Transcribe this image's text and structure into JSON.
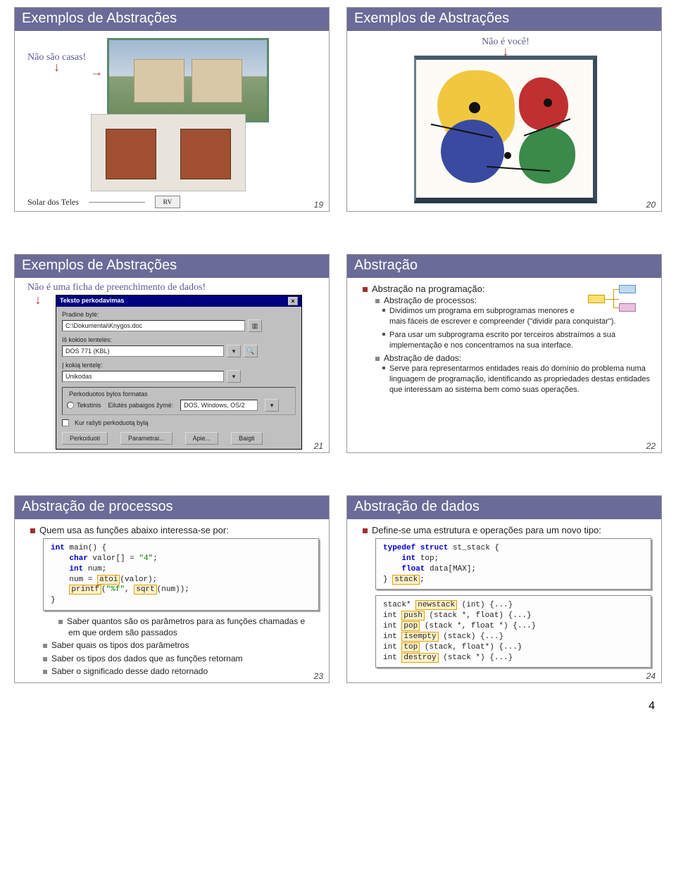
{
  "page_number_bottom": "4",
  "slides": {
    "s19": {
      "title": "Exemplos de Abstrações",
      "annotation": "Não são casas!",
      "bottom_label": "Solar dos Teles",
      "rv_label": "RV",
      "num": "19"
    },
    "s20": {
      "title": "Exemplos de Abstrações",
      "annotation": "Não é você!",
      "num": "20"
    },
    "s21": {
      "title": "Exemplos de Abstrações",
      "annotation": "Não é uma ficha de preenchimento de dados!",
      "dialog": {
        "title": "Teksto perkodavimas",
        "close": "×",
        "f1_label": "Pradinė bylė:",
        "f1_value": "C:\\Dokumentai\\Knygos.doc",
        "f2_label": "Iš kokios lentelės:",
        "f2_value": "DOS 771 (KBL)",
        "f3_label": "Į kokią lentelę:",
        "f3_value": "Unikodas",
        "row_label": "Perkoduotos bylos formatas",
        "opt1": "Tekstinis",
        "opt2_prefix": "Eilutės pabaigos žymė:",
        "opt2_value": "DOS, Windows, OS/2",
        "chk_label": "Kur rašyti perkoduotą bylą",
        "buttons": [
          "Perkoduoti",
          "Parametrai...",
          "Apie...",
          "Baigti"
        ]
      },
      "num": "21"
    },
    "s22": {
      "title": "Abstração",
      "l1": "Abstração na programação:",
      "l2a": "Abstração de processos:",
      "l3a": "Dividimos um programa em subprogramas menores e mais fáceis de escrever e compreender (\"dividir para conquistar\").",
      "l3b": "Para usar um subprograma escrito por terceiros abstraímos a sua implementação e nos concentramos na sua interface.",
      "l2b": "Abstração de dados:",
      "l3c": "Serve para representarmos entidades reais do domínio do problema numa linguagem de programação, identificando as propriedades destas entidades que interessam ao sistema bem como suas operações.",
      "num": "22"
    },
    "s23": {
      "title": "Abstração de processos",
      "l1": "Quem usa as funções abaixo interessa-se por:",
      "code": {
        "l1a": "int",
        "l1b": " main() {",
        "l2a": "char",
        "l2b": " valor[] = ",
        "l2c": "\"4\"",
        "l2d": ";",
        "l3a": "int",
        "l3b": " num;",
        "l4a": "    num = ",
        "l4b": "atoi",
        "l4c": "(valor);",
        "l5a": "printf",
        "l5b": "(",
        "l5c": "\"%f\"",
        "l5d": ", ",
        "l5e": "sqrt",
        "l5f": "(num));",
        "l6": "}"
      },
      "b1": "Saber quantos são os parâmetros para as funções chamadas e em que ordem são passados",
      "b2": "Saber quais os tipos dos parâmetros",
      "b3": "Saber os tipos dos dados que as funções retornam",
      "b4": "Saber o significado desse dado retornado",
      "num": "23"
    },
    "s24": {
      "title": "Abstração de dados",
      "l1": "Define-se uma estrutura e operações para um novo tipo:",
      "code1": {
        "a": "typedef struct",
        "b": " st_stack {",
        "c": "int",
        "d": " top;",
        "e": "float",
        "f": " data[MAX];",
        "g": "} ",
        "h": "stack",
        "i": ";"
      },
      "code2": {
        "l1a": "stack* ",
        "l1b": "newstack",
        "l1c": " (int) {...}",
        "l2a": "int ",
        "l2b": "push",
        "l2c": " (stack *, float) {...}",
        "l3a": "int ",
        "l3b": "pop",
        "l3c": " (stack *, float *) {...}",
        "l4a": "int ",
        "l4b": "isempty",
        "l4c": " (stack) {...}",
        "l5a": "int ",
        "l5b": "top",
        "l5c": " (stack, float*) {...}",
        "l6a": "int ",
        "l6b": "destroy",
        "l6c": " (stack *) {...}"
      },
      "num": "24"
    }
  }
}
